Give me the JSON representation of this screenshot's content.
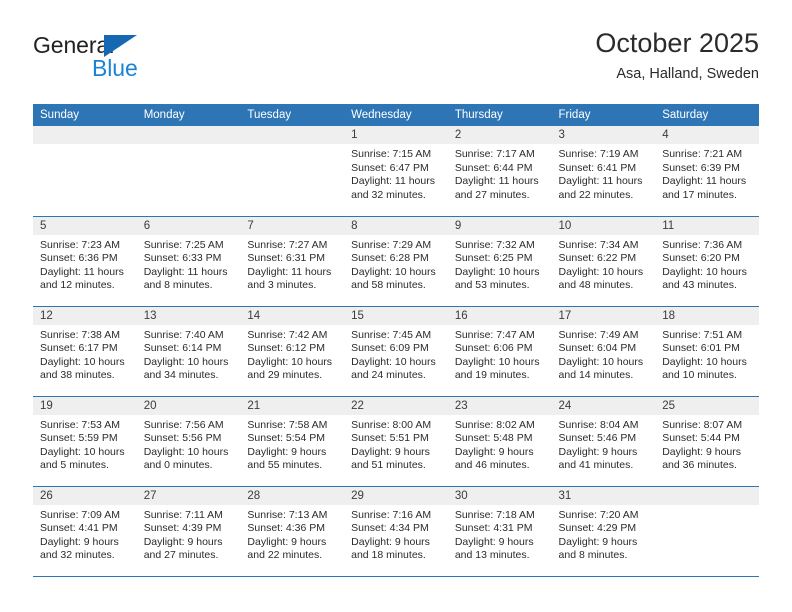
{
  "brand": {
    "line1": "General",
    "line2": "Blue",
    "flag_color": "#1668b3",
    "blue_text_color": "#1b83d6"
  },
  "header": {
    "title": "October 2025",
    "location": "Asa, Halland, Sweden"
  },
  "theme": {
    "header_blue": "#2e75b6",
    "daynum_band": "#efefef",
    "text": "#2b2b2b"
  },
  "weekdays": [
    "Sunday",
    "Monday",
    "Tuesday",
    "Wednesday",
    "Thursday",
    "Friday",
    "Saturday"
  ],
  "labels": {
    "sunrise": "Sunrise:",
    "sunset": "Sunset:",
    "daylight": "Daylight:"
  },
  "weeks": [
    [
      {
        "day": "",
        "empty": true
      },
      {
        "day": "",
        "empty": true
      },
      {
        "day": "",
        "empty": true
      },
      {
        "day": "1",
        "sunrise": "Sunrise: 7:15 AM",
        "sunset": "Sunset: 6:47 PM",
        "daylight1": "Daylight: 11 hours",
        "daylight2": "and 32 minutes."
      },
      {
        "day": "2",
        "sunrise": "Sunrise: 7:17 AM",
        "sunset": "Sunset: 6:44 PM",
        "daylight1": "Daylight: 11 hours",
        "daylight2": "and 27 minutes."
      },
      {
        "day": "3",
        "sunrise": "Sunrise: 7:19 AM",
        "sunset": "Sunset: 6:41 PM",
        "daylight1": "Daylight: 11 hours",
        "daylight2": "and 22 minutes."
      },
      {
        "day": "4",
        "sunrise": "Sunrise: 7:21 AM",
        "sunset": "Sunset: 6:39 PM",
        "daylight1": "Daylight: 11 hours",
        "daylight2": "and 17 minutes."
      }
    ],
    [
      {
        "day": "5",
        "sunrise": "Sunrise: 7:23 AM",
        "sunset": "Sunset: 6:36 PM",
        "daylight1": "Daylight: 11 hours",
        "daylight2": "and 12 minutes."
      },
      {
        "day": "6",
        "sunrise": "Sunrise: 7:25 AM",
        "sunset": "Sunset: 6:33 PM",
        "daylight1": "Daylight: 11 hours",
        "daylight2": "and 8 minutes."
      },
      {
        "day": "7",
        "sunrise": "Sunrise: 7:27 AM",
        "sunset": "Sunset: 6:31 PM",
        "daylight1": "Daylight: 11 hours",
        "daylight2": "and 3 minutes."
      },
      {
        "day": "8",
        "sunrise": "Sunrise: 7:29 AM",
        "sunset": "Sunset: 6:28 PM",
        "daylight1": "Daylight: 10 hours",
        "daylight2": "and 58 minutes."
      },
      {
        "day": "9",
        "sunrise": "Sunrise: 7:32 AM",
        "sunset": "Sunset: 6:25 PM",
        "daylight1": "Daylight: 10 hours",
        "daylight2": "and 53 minutes."
      },
      {
        "day": "10",
        "sunrise": "Sunrise: 7:34 AM",
        "sunset": "Sunset: 6:22 PM",
        "daylight1": "Daylight: 10 hours",
        "daylight2": "and 48 minutes."
      },
      {
        "day": "11",
        "sunrise": "Sunrise: 7:36 AM",
        "sunset": "Sunset: 6:20 PM",
        "daylight1": "Daylight: 10 hours",
        "daylight2": "and 43 minutes."
      }
    ],
    [
      {
        "day": "12",
        "sunrise": "Sunrise: 7:38 AM",
        "sunset": "Sunset: 6:17 PM",
        "daylight1": "Daylight: 10 hours",
        "daylight2": "and 38 minutes."
      },
      {
        "day": "13",
        "sunrise": "Sunrise: 7:40 AM",
        "sunset": "Sunset: 6:14 PM",
        "daylight1": "Daylight: 10 hours",
        "daylight2": "and 34 minutes."
      },
      {
        "day": "14",
        "sunrise": "Sunrise: 7:42 AM",
        "sunset": "Sunset: 6:12 PM",
        "daylight1": "Daylight: 10 hours",
        "daylight2": "and 29 minutes."
      },
      {
        "day": "15",
        "sunrise": "Sunrise: 7:45 AM",
        "sunset": "Sunset: 6:09 PM",
        "daylight1": "Daylight: 10 hours",
        "daylight2": "and 24 minutes."
      },
      {
        "day": "16",
        "sunrise": "Sunrise: 7:47 AM",
        "sunset": "Sunset: 6:06 PM",
        "daylight1": "Daylight: 10 hours",
        "daylight2": "and 19 minutes."
      },
      {
        "day": "17",
        "sunrise": "Sunrise: 7:49 AM",
        "sunset": "Sunset: 6:04 PM",
        "daylight1": "Daylight: 10 hours",
        "daylight2": "and 14 minutes."
      },
      {
        "day": "18",
        "sunrise": "Sunrise: 7:51 AM",
        "sunset": "Sunset: 6:01 PM",
        "daylight1": "Daylight: 10 hours",
        "daylight2": "and 10 minutes."
      }
    ],
    [
      {
        "day": "19",
        "sunrise": "Sunrise: 7:53 AM",
        "sunset": "Sunset: 5:59 PM",
        "daylight1": "Daylight: 10 hours",
        "daylight2": "and 5 minutes."
      },
      {
        "day": "20",
        "sunrise": "Sunrise: 7:56 AM",
        "sunset": "Sunset: 5:56 PM",
        "daylight1": "Daylight: 10 hours",
        "daylight2": "and 0 minutes."
      },
      {
        "day": "21",
        "sunrise": "Sunrise: 7:58 AM",
        "sunset": "Sunset: 5:54 PM",
        "daylight1": "Daylight: 9 hours",
        "daylight2": "and 55 minutes."
      },
      {
        "day": "22",
        "sunrise": "Sunrise: 8:00 AM",
        "sunset": "Sunset: 5:51 PM",
        "daylight1": "Daylight: 9 hours",
        "daylight2": "and 51 minutes."
      },
      {
        "day": "23",
        "sunrise": "Sunrise: 8:02 AM",
        "sunset": "Sunset: 5:48 PM",
        "daylight1": "Daylight: 9 hours",
        "daylight2": "and 46 minutes."
      },
      {
        "day": "24",
        "sunrise": "Sunrise: 8:04 AM",
        "sunset": "Sunset: 5:46 PM",
        "daylight1": "Daylight: 9 hours",
        "daylight2": "and 41 minutes."
      },
      {
        "day": "25",
        "sunrise": "Sunrise: 8:07 AM",
        "sunset": "Sunset: 5:44 PM",
        "daylight1": "Daylight: 9 hours",
        "daylight2": "and 36 minutes."
      }
    ],
    [
      {
        "day": "26",
        "sunrise": "Sunrise: 7:09 AM",
        "sunset": "Sunset: 4:41 PM",
        "daylight1": "Daylight: 9 hours",
        "daylight2": "and 32 minutes."
      },
      {
        "day": "27",
        "sunrise": "Sunrise: 7:11 AM",
        "sunset": "Sunset: 4:39 PM",
        "daylight1": "Daylight: 9 hours",
        "daylight2": "and 27 minutes."
      },
      {
        "day": "28",
        "sunrise": "Sunrise: 7:13 AM",
        "sunset": "Sunset: 4:36 PM",
        "daylight1": "Daylight: 9 hours",
        "daylight2": "and 22 minutes."
      },
      {
        "day": "29",
        "sunrise": "Sunrise: 7:16 AM",
        "sunset": "Sunset: 4:34 PM",
        "daylight1": "Daylight: 9 hours",
        "daylight2": "and 18 minutes."
      },
      {
        "day": "30",
        "sunrise": "Sunrise: 7:18 AM",
        "sunset": "Sunset: 4:31 PM",
        "daylight1": "Daylight: 9 hours",
        "daylight2": "and 13 minutes."
      },
      {
        "day": "31",
        "sunrise": "Sunrise: 7:20 AM",
        "sunset": "Sunset: 4:29 PM",
        "daylight1": "Daylight: 9 hours",
        "daylight2": "and 8 minutes."
      },
      {
        "day": "",
        "empty": true
      }
    ]
  ]
}
